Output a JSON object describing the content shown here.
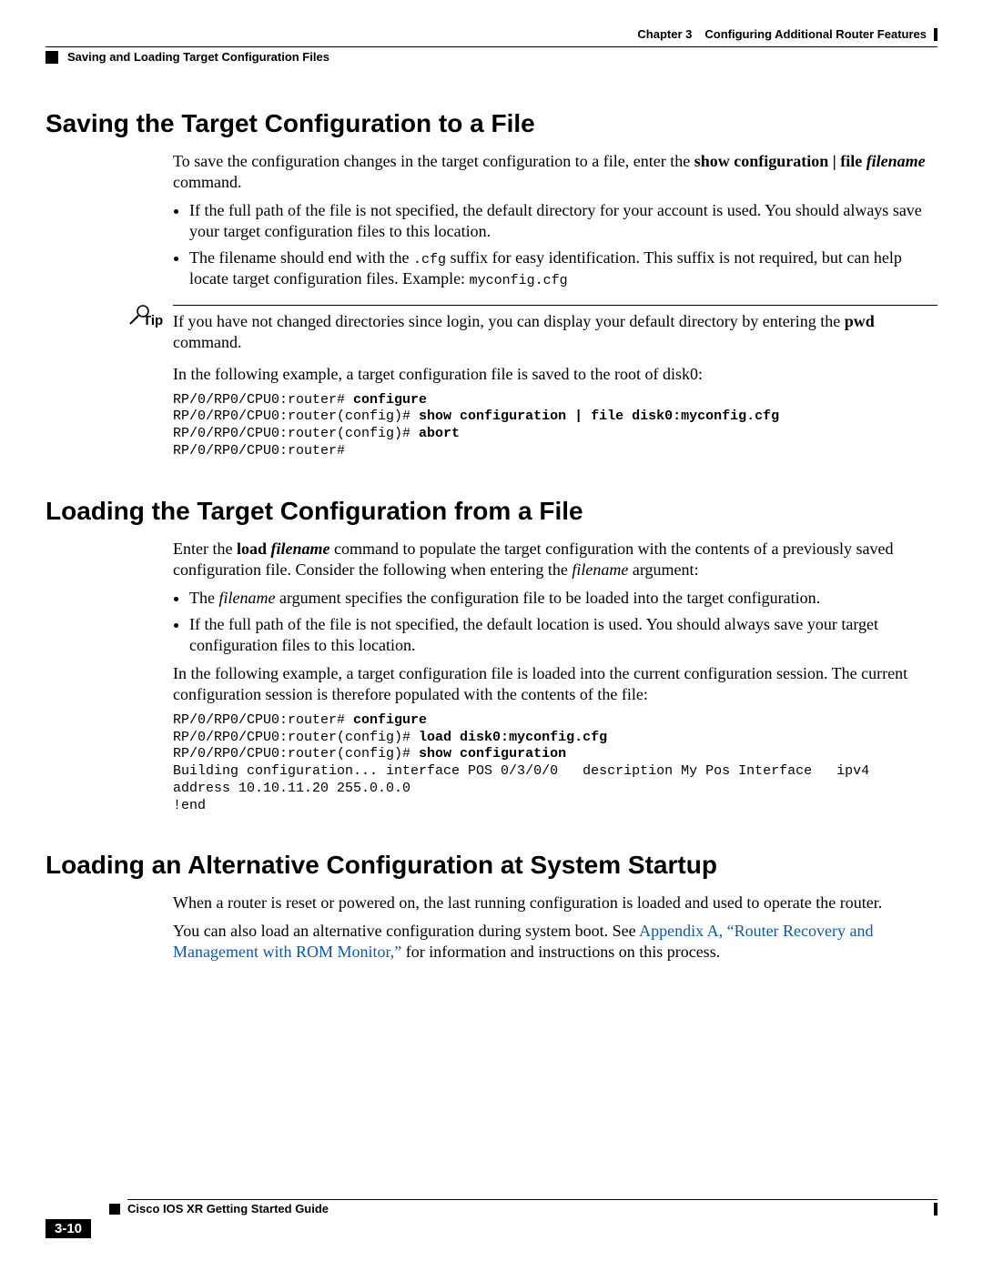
{
  "header": {
    "chapter_num": "Chapter 3",
    "chapter_title": "Configuring Additional Router Features",
    "section_title": "Saving and Loading Target Configuration Files"
  },
  "sec1": {
    "heading": "Saving the Target Configuration to a File",
    "intro_pre": "To save the configuration changes in the target configuration to a file, enter the ",
    "cmd1": "show configuration | file",
    "filename_arg": " filename",
    "intro_post": " command.",
    "bul1": "If the full path of the file is not specified, the default directory for your account is used. You should always save your target configuration files to this location.",
    "bul2_pre": "The filename should end with the ",
    "bul2_code": ".cfg",
    "bul2_mid": " suffix for easy identification. This suffix is not required, but can help locate target configuration files. Example: ",
    "bul2_ex": "myconfig.cfg",
    "tip_label": "Tip",
    "tip_text_pre": "If you have not changed directories since login, you can display your default directory by entering the ",
    "tip_cmd": "pwd",
    "tip_text_post": " command.",
    "ex_intro": "In the following example, a target configuration file is saved to the root of disk0:",
    "code_l1_p": "RP/0/RP0/CPU0:router# ",
    "code_l1_c": "configure",
    "code_l2_p": "RP/0/RP0/CPU0:router(config)# ",
    "code_l2_c": "show configuration | file disk0:myconfig.cfg",
    "code_l3_p": "RP/0/RP0/CPU0:router(config)# ",
    "code_l3_c": "abort",
    "code_l4": "RP/0/RP0/CPU0:router#"
  },
  "sec2": {
    "heading": "Loading the Target Configuration from a File",
    "intro_pre": "Enter the ",
    "cmd1": "load",
    "filename_arg": " filename",
    "intro_mid": " command to populate the target configuration with the contents of a previously saved configuration file. Consider the following when entering the ",
    "filename_ital": "filename",
    "intro_post": " argument:",
    "bul1_pre": "The ",
    "bul1_it": "filename",
    "bul1_post": " argument specifies the configuration file to be loaded into the target configuration.",
    "bul2": "If the full path of the file is not specified, the default location is used. You should always save your target configuration files to this location.",
    "ex_intro": "In the following example, a target configuration file is loaded into the current configuration session. The current configuration session is therefore populated with the contents of the file:",
    "code_l1_p": "RP/0/RP0/CPU0:router# ",
    "code_l1_c": "configure",
    "code_l2_p": "RP/0/RP0/CPU0:router(config)# ",
    "code_l2_c": "load disk0:myconfig.cfg",
    "code_l3_p": "RP/0/RP0/CPU0:router(config)# ",
    "code_l3_c": "show configuration",
    "code_l4": "Building configuration... interface POS 0/3/0/0   description My Pos Interface   ipv4",
    "code_l5": "address 10.10.11.20 255.0.0.0",
    "code_l6": "!end"
  },
  "sec3": {
    "heading": "Loading an Alternative Configuration at System Startup",
    "p1": "When a router is reset or powered on, the last running configuration is loaded and used to operate the router.",
    "p2_pre": "You can also load an alternative configuration during system boot. See ",
    "link": "Appendix A, “Router Recovery and Management with ROM Monitor,”",
    "p2_post": " for information and instructions on this process."
  },
  "footer": {
    "guide": "Cisco IOS XR Getting Started Guide",
    "page": "3-10"
  }
}
